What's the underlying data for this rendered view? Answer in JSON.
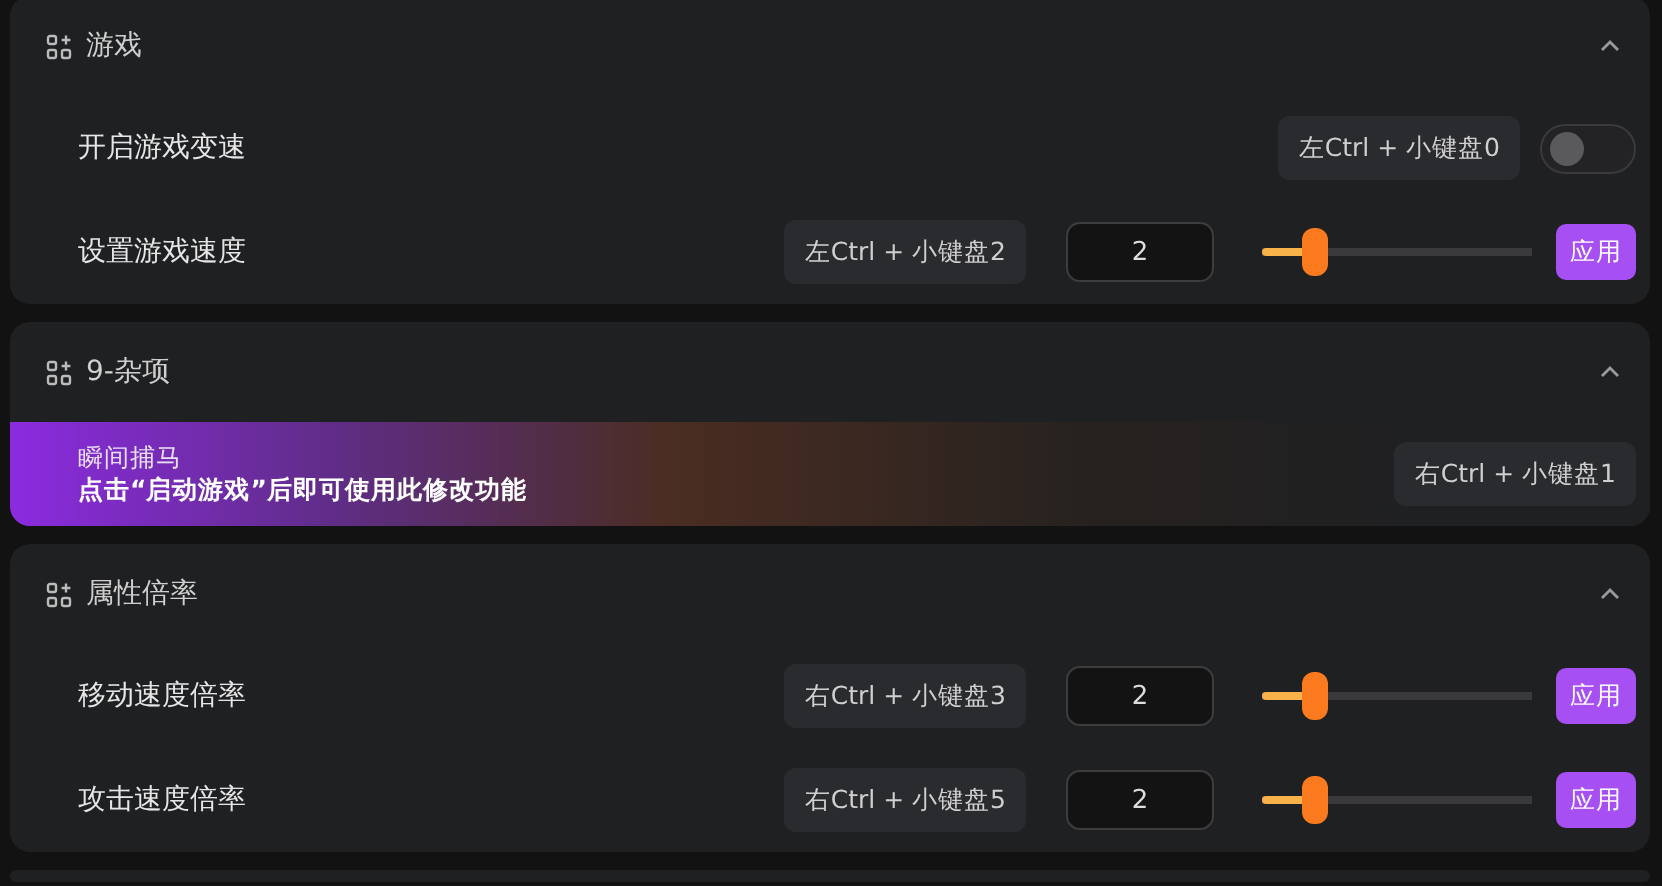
{
  "sections": [
    {
      "title": "游戏",
      "expanded": true,
      "rows": [
        {
          "kind": "toggle",
          "label": "开启游戏变速",
          "hotkey": "左Ctrl + 小键盘0",
          "on": false
        },
        {
          "kind": "slider",
          "label": "设置游戏速度",
          "hotkey": "左Ctrl + 小键盘2",
          "value": "2",
          "level": 0.19,
          "button": "应用"
        }
      ]
    },
    {
      "title": "9-杂项",
      "expanded": true,
      "rows": [
        {
          "kind": "banner",
          "label": "瞬间捕马",
          "message": "点击“启动游戏”后即可使用此修改功能",
          "hotkey": "右Ctrl + 小键盘1"
        }
      ]
    },
    {
      "title": "属性倍率",
      "expanded": true,
      "rows": [
        {
          "kind": "slider",
          "label": "移动速度倍率",
          "hotkey": "右Ctrl + 小键盘3",
          "value": "2",
          "level": 0.19,
          "button": "应用"
        },
        {
          "kind": "slider",
          "label": "攻击速度倍率",
          "hotkey": "右Ctrl + 小键盘5",
          "value": "2",
          "level": 0.19,
          "button": "应用"
        }
      ]
    }
  ]
}
